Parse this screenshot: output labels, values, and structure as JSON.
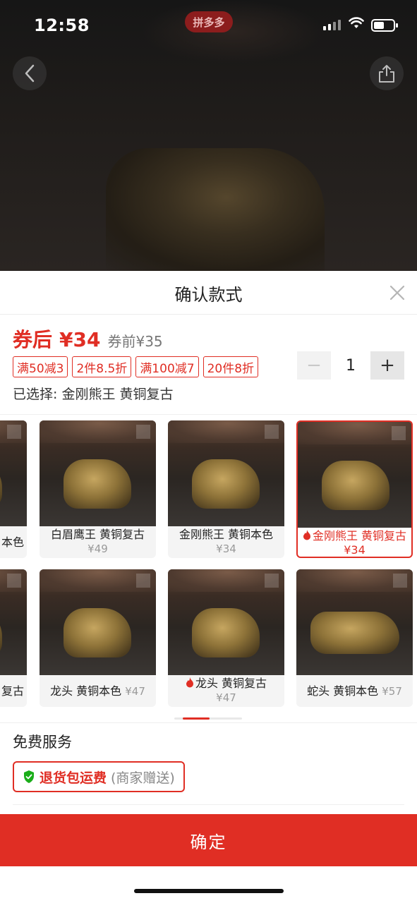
{
  "status_bar": {
    "time": "12:58",
    "app_badge": "拼多多",
    "battery_level": 0.55
  },
  "sheet": {
    "title": "确认款式",
    "price": {
      "label": "券后",
      "value": "¥34",
      "before": "券前¥35"
    },
    "promos": [
      "满50减3",
      "2件8.5折",
      "满100减7",
      "20件8折"
    ],
    "quantity": {
      "minus": "−",
      "value": "1",
      "plus": "+"
    },
    "selected_text": "已选择: 金刚熊王 黄铜复古",
    "options": [
      {
        "name": "本色",
        "price": ""
      },
      {
        "name": "白眉鹰王 黄铜复古",
        "price": "¥49"
      },
      {
        "name": "金刚熊王 黄铜本色",
        "price": "¥34"
      },
      {
        "name": "金刚熊王 黄铜复古 ¥34",
        "price": "",
        "hot": true,
        "selected": true
      },
      {
        "name": "复古",
        "price": ""
      },
      {
        "name": "龙头 黄铜本色",
        "price": "¥47"
      },
      {
        "name": "龙头 黄铜复古",
        "price": "¥47",
        "hot": true
      },
      {
        "name": "蛇头 黄铜本色",
        "price": "¥57"
      }
    ],
    "services": {
      "title": "免费服务",
      "tag_main": "退货包运费",
      "tag_note": "(商家赠送)"
    },
    "confirm_label": "确定"
  },
  "colors": {
    "accent": "#e02e24",
    "service_check": "#1aad19"
  },
  "icons": [
    "back-arrow-icon",
    "share-icon",
    "close-icon",
    "expand-icon",
    "fire-icon",
    "shield-check-icon",
    "wifi-icon",
    "signal-icon",
    "battery-icon"
  ]
}
